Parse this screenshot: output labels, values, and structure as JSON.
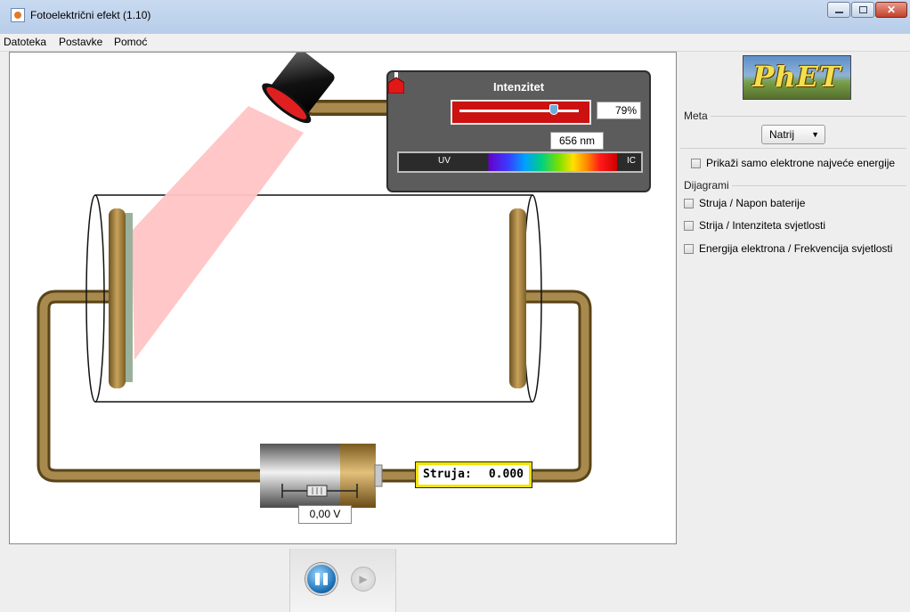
{
  "window": {
    "title": "Fotoelektrični efekt (1.10)"
  },
  "menu": {
    "items": [
      "Datoteka",
      "Postavke",
      "Pomoć"
    ]
  },
  "intensity_panel": {
    "title": "Intenzitet",
    "intensity_percent": 79,
    "intensity_display": "79%",
    "wavelength_display": "656 nm",
    "spectrum_left_label": "UV",
    "spectrum_right_label": "IC"
  },
  "circuit": {
    "current_label": "Struja:",
    "current_value": "0.000",
    "battery_voltage": "0,00 V"
  },
  "side_panel": {
    "logo_text": "PhET",
    "target_group_title": "Meta",
    "target_selected": "Natrij",
    "max_energy_checkbox": "Prikaži samo elektrone najveće energije",
    "diagrams_group_title": "Dijagrami",
    "diagram_options": [
      "Struja / Napon baterije",
      "Strija / Intenziteta svjetlosti",
      "Energija elektrona / Frekvencija svjetlosti"
    ]
  },
  "icons": {
    "app": "java-app-icon",
    "lamp": "lamp-icon",
    "pause": "pause-icon",
    "step": "step-forward-icon",
    "dropdown": "chevron-down-icon"
  },
  "colors": {
    "beam": "#ffc4c4",
    "wire": "#8a6b32",
    "meter_border": "#f2e400",
    "slider_fill": "#cc1111"
  }
}
